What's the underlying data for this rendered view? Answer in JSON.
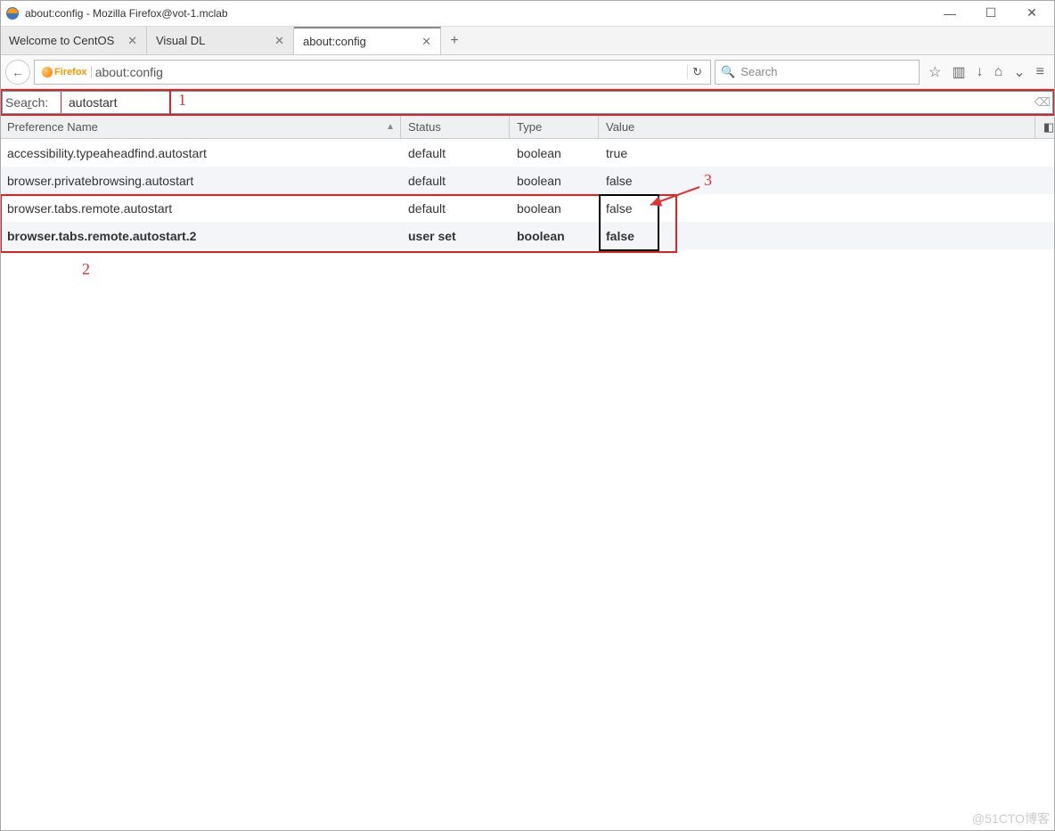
{
  "window": {
    "title": "about:config - Mozilla Firefox@vot-1.mclab"
  },
  "tabs": [
    {
      "label": "Welcome to CentOS"
    },
    {
      "label": "Visual DL"
    },
    {
      "label": "about:config"
    }
  ],
  "urlbar": {
    "badge": "Firefox",
    "url": "about:config"
  },
  "searchbar": {
    "placeholder": "Search"
  },
  "filter": {
    "label_pre": "Sea",
    "label_u": "r",
    "label_post": "ch:",
    "value": "autostart"
  },
  "columns": {
    "name": "Preference Name",
    "status": "Status",
    "type": "Type",
    "value": "Value"
  },
  "rows": [
    {
      "name": "accessibility.typeaheadfind.autostart",
      "status": "default",
      "type": "boolean",
      "value": "true",
      "bold": false
    },
    {
      "name": "browser.privatebrowsing.autostart",
      "status": "default",
      "type": "boolean",
      "value": "false",
      "bold": false
    },
    {
      "name": "browser.tabs.remote.autostart",
      "status": "default",
      "type": "boolean",
      "value": "false",
      "bold": false
    },
    {
      "name": "browser.tabs.remote.autostart.2",
      "status": "user set",
      "type": "boolean",
      "value": "false",
      "bold": true
    }
  ],
  "annotations": {
    "a1": "1",
    "a2": "2",
    "a3": "3"
  },
  "watermark": "@51CTO博客"
}
